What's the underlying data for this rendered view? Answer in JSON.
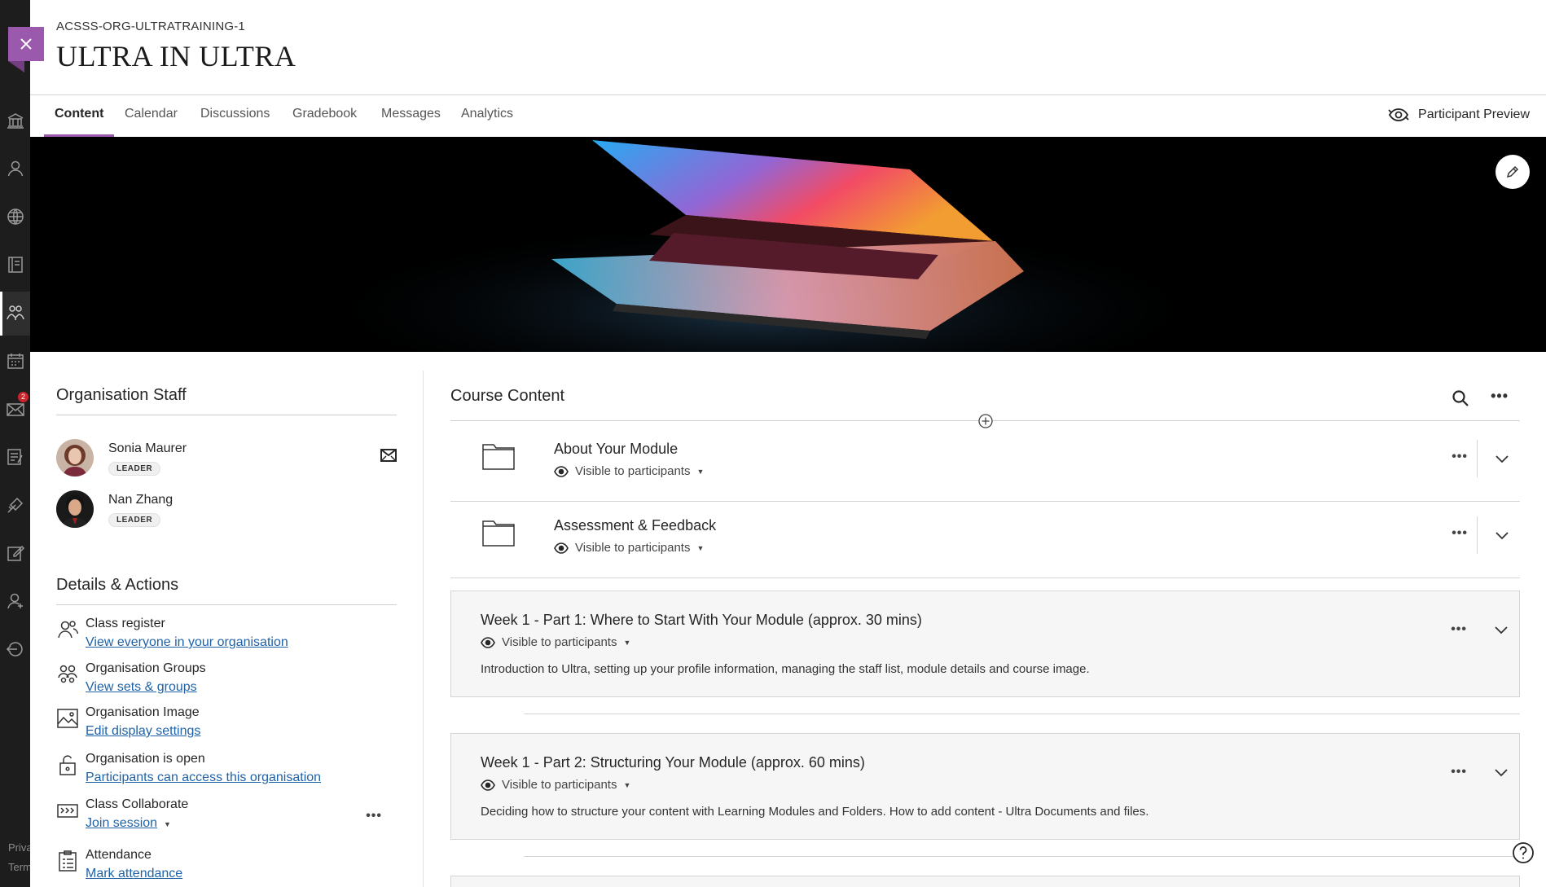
{
  "course": {
    "id": "ACSSS-ORG-ULTRATRAINING-1",
    "title": "ULTRA IN ULTRA"
  },
  "left_rail": {
    "badge_count": "2",
    "footer": [
      "Privacy",
      "Terms"
    ]
  },
  "tabs": [
    {
      "label": "Content",
      "active": true
    },
    {
      "label": "Calendar"
    },
    {
      "label": "Discussions"
    },
    {
      "label": "Gradebook"
    },
    {
      "label": "Messages"
    },
    {
      "label": "Analytics"
    }
  ],
  "participant_preview": "Participant Preview",
  "org_staff": {
    "heading": "Organisation Staff",
    "members": [
      {
        "name": "Sonia Maurer",
        "role": "LEADER"
      },
      {
        "name": "Nan Zhang",
        "role": "LEADER"
      }
    ]
  },
  "details": {
    "heading": "Details & Actions",
    "items": [
      {
        "title": "Class register",
        "link": "View everyone in your organisation"
      },
      {
        "title": "Organisation Groups",
        "link": "View sets & groups"
      },
      {
        "title": "Organisation Image",
        "link": "Edit display settings"
      },
      {
        "title": "Organisation is open",
        "link": "Participants can access this organisation"
      },
      {
        "title": "Class Collaborate",
        "link": "Join session"
      },
      {
        "title": "Attendance",
        "link": "Mark attendance"
      }
    ]
  },
  "course_content": {
    "heading": "Course Content",
    "visibility_label": "Visible to participants",
    "folders": [
      {
        "title": "About Your Module"
      },
      {
        "title": "Assessment & Feedback"
      }
    ],
    "modules": [
      {
        "title": "Week 1 - Part 1: Where to Start With Your Module (approx. 30 mins)",
        "description": "Introduction to Ultra, setting up your profile information, managing the staff list, module details and course image."
      },
      {
        "title": "Week 1 - Part 2: Structuring Your Module (approx. 60 mins)",
        "description": "Deciding how to structure your content with Learning Modules and Folders. How to add content - Ultra Documents and files."
      }
    ]
  },
  "colors": {
    "accent": "#9a59ad",
    "link": "#1f62a7",
    "rail": "#1d1d1d"
  }
}
